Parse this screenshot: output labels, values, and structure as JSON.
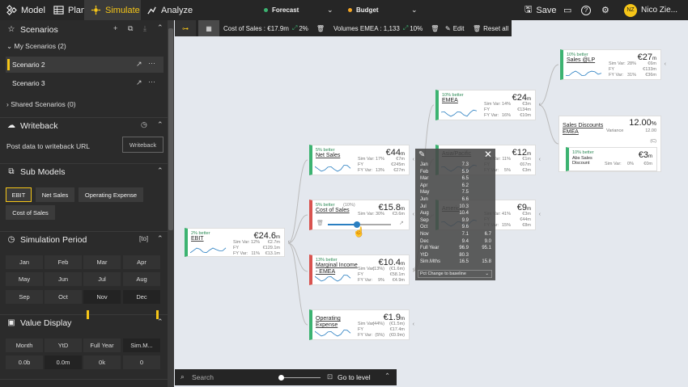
{
  "topbar": {
    "model": "Model",
    "plan": "Plan",
    "simulate": "Simulate",
    "analyze": "Analyze",
    "forecast": "Forecast",
    "budget": "Budget",
    "save": "Save",
    "user_initials": "NZ",
    "user_name": "Nico Zie...",
    "forecast_color": "#3cb371",
    "budget_color": "#f5a623"
  },
  "sidebar": {
    "scenarios": "Scenarios",
    "my_scenarios": "My Scenarios (2)",
    "scenario2": "Scenario 2",
    "scenario3": "Scenario 3",
    "shared": "Shared Scenarios (0)",
    "writeback": "Writeback",
    "writeback_text": "Post data to writeback URL",
    "writeback_btn": "Writeback",
    "submodels": "Sub Models",
    "sm": [
      "EBIT",
      "Net Sales",
      "Operating Expense",
      "Cost of Sales"
    ],
    "simperiod": "Simulation Period",
    "simperiod_tag": "[to]",
    "months": [
      "Jan",
      "Feb",
      "Mar",
      "Apr",
      "May",
      "Jun",
      "Jul",
      "Aug",
      "Sep",
      "Oct",
      "Nov",
      "Dec"
    ],
    "valuedisplay": "Value Display",
    "vd_heads": [
      "Month",
      "YtD",
      "Full Year",
      "Sim.M..."
    ],
    "vd_vals": [
      "0.0b",
      "0.0m",
      "0k",
      "0"
    ]
  },
  "toolbar": {
    "cost": "Cost of Sales : €17.9m",
    "cost_pct": "2%",
    "vol": "Volumes EMEA : 1,133",
    "vol_pct": "10%",
    "edit": "Edit",
    "reset": "Reset all"
  },
  "nodes": {
    "ebit": {
      "better": "2% better",
      "name": "EBIT",
      "val": "€24.6",
      "unit": "m",
      "l1": "Sim Var:",
      "l2": "FY",
      "l3": "FY Var:",
      "v1": "12%",
      "v2": "€2.7m",
      "v3": "€129.1m",
      "v4": "11%",
      "v5": "€13.1m"
    },
    "netsales": {
      "better": "5% better",
      "name": "Net Sales",
      "val": "€44",
      "unit": "m",
      "v1": "17%",
      "v2": "€7m",
      "v3": "€245m",
      "v4": "13%",
      "v5": "€27m"
    },
    "cos": {
      "better": "5% better",
      "pct": "(10%)",
      "name": "Cost of Sales",
      "val": "€15.8",
      "unit": "m",
      "v1": "30%",
      "v2": "€3.6m"
    },
    "mi": {
      "better": "13% better",
      "name": "Marginal Income - EMEA",
      "val": "€10.4",
      "unit": "m",
      "v1": "(13%)",
      "v2": "(€1.6m)",
      "v3": "€58.1m",
      "v4": "9%",
      "v5": "€4.9m"
    },
    "opex": {
      "name": "Operating Expense",
      "val": "€1.9",
      "unit": "m",
      "v1": "(44%)",
      "v2": "(€1.5m)",
      "v3": "€17.4m",
      "v4": "(5%)",
      "v5": "(€0.9m)"
    },
    "emea": {
      "better": "10% better",
      "name": "EMEA",
      "val": "€24",
      "unit": "m",
      "v1": "14%",
      "v2": "€3m",
      "v3": "€134m",
      "v4": "16%",
      "v5": "€10m"
    },
    "asia": {
      "name": "Asia/Pacific",
      "val": "€12",
      "unit": "m",
      "v1": "11%",
      "v2": "€1m",
      "v3": "€67m",
      "v4": "5%",
      "v5": "€3m"
    },
    "americas": {
      "name": "Americas",
      "val": "€9",
      "unit": "m",
      "v1": "41%",
      "v2": "€3m",
      "v3": "€44m",
      "v4": "15%",
      "v5": "€8m"
    },
    "saleslp": {
      "better": "10% better",
      "name": "Sales @LP",
      "val": "€27",
      "unit": "m",
      "v1": "28%",
      "v2": "€6m",
      "v3": "€133m",
      "v4": "31%",
      "v5": "€36m"
    },
    "sd": {
      "name": "Sales Discounts EMEA",
      "variance": "Variance",
      "val": "12.00",
      "unit": "%",
      "sub": "12.00",
      "c": "(C)"
    },
    "abs": {
      "better": "10% better",
      "name": "Abs Sales Discount",
      "l1": "Sim Var:",
      "val": "€3",
      "unit": "m",
      "v1": "0%",
      "v2": "€0m"
    }
  },
  "labels": {
    "simvar": "Sim Var:",
    "fy": "FY",
    "fyvar": "FY Var:"
  },
  "popup": {
    "rows": [
      [
        "Jan",
        "7.3",
        ""
      ],
      [
        "Feb",
        "5.9",
        ""
      ],
      [
        "Mar",
        "6.5",
        ""
      ],
      [
        "Apr",
        "6.2",
        ""
      ],
      [
        "May",
        "7.5",
        ""
      ],
      [
        "Jun",
        "6.6",
        ""
      ],
      [
        "Jul",
        "10.3",
        ""
      ],
      [
        "Aug",
        "10.4",
        ""
      ],
      [
        "Sep",
        "9.9",
        ""
      ],
      [
        "Oct",
        "9.6",
        ""
      ],
      [
        "Nov",
        "7.1",
        "6.7"
      ],
      [
        "Dec",
        "9.4",
        "9.0"
      ],
      [
        "Full Year",
        "96.9",
        "95.1"
      ],
      [
        "YtD",
        "80.3",
        ""
      ],
      [
        "Sim.Mths",
        "16.5",
        "15.8"
      ]
    ],
    "dropdown": "Pct Change to baseline"
  },
  "bottom": {
    "search": "Search",
    "goto": "Go to level"
  }
}
